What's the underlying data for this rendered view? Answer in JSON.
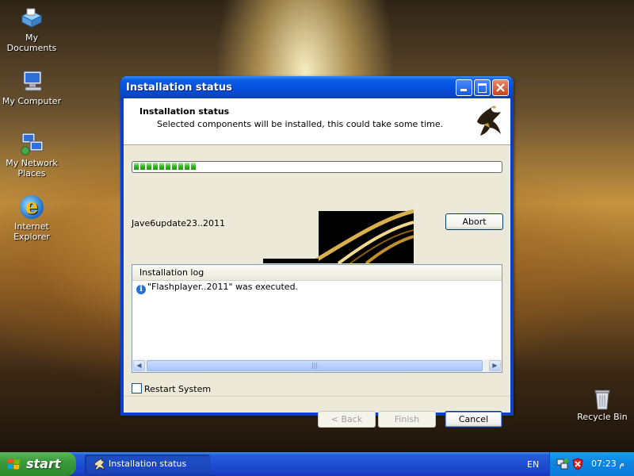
{
  "desktop": {
    "icons": [
      {
        "label": "My Documents"
      },
      {
        "label": "My Computer"
      },
      {
        "label": "My Network Places"
      },
      {
        "label": "Internet Explorer"
      },
      {
        "label": "Recycle Bin"
      }
    ]
  },
  "window": {
    "title": "Installation status",
    "header": {
      "title": "Installation status",
      "subtitle": "Selected components will be installed, this could take some time."
    },
    "progress": {
      "value": 0.17
    },
    "current_item": "Jave6update23..2011",
    "abort_label": "Abort",
    "log": {
      "header": "Installation log",
      "entries": [
        "\"Flashplayer..2011\" was executed."
      ]
    },
    "restart_label": "Restart System",
    "restart_checked": false,
    "buttons": {
      "back": "< Back",
      "finish": "Finish",
      "cancel": "Cancel"
    }
  },
  "taskbar": {
    "start_label": "start",
    "task_label": "Installation status",
    "language": "EN",
    "clock": "07:23 م"
  }
}
